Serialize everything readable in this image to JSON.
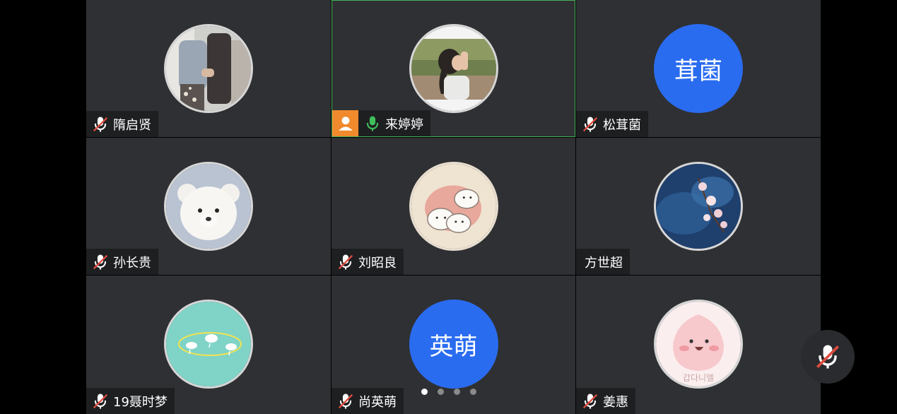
{
  "participants": [
    {
      "name": "隋启贤",
      "mic": "muted",
      "avatar": "photo-people"
    },
    {
      "name": "来婷婷",
      "mic": "active",
      "avatar": "photo-girl",
      "host": true,
      "speaking": true
    },
    {
      "name": "松茸菌",
      "mic": "muted",
      "avatar_text": "茸菌"
    },
    {
      "name": "孙长贵",
      "mic": "muted",
      "avatar": "photo-teddy-bear"
    },
    {
      "name": "刘昭良",
      "mic": "muted",
      "avatar": "cartoon-rabbits"
    },
    {
      "name": "方世超",
      "mic": "none",
      "avatar": "painting-blossoms"
    },
    {
      "name": "19聂时梦",
      "mic": "muted",
      "avatar": "cloud-illustration"
    },
    {
      "name": "尚英萌",
      "mic": "muted",
      "avatar_text": "英萌"
    },
    {
      "name": "姜惠",
      "mic": "muted",
      "avatar": "peach-character",
      "avatar_caption": "갑다니엘"
    }
  ],
  "pager": {
    "count": 4,
    "current": 1
  },
  "colors": {
    "tile_bg": "#2f3033",
    "active_border": "#46b35a",
    "avatar_blue": "#2a6cf0",
    "mic_muted": "#e04b3f",
    "mic_active": "#3fbf5a",
    "host_badge": "#f08a2c"
  },
  "controls": {
    "self_mic_state": "muted"
  }
}
